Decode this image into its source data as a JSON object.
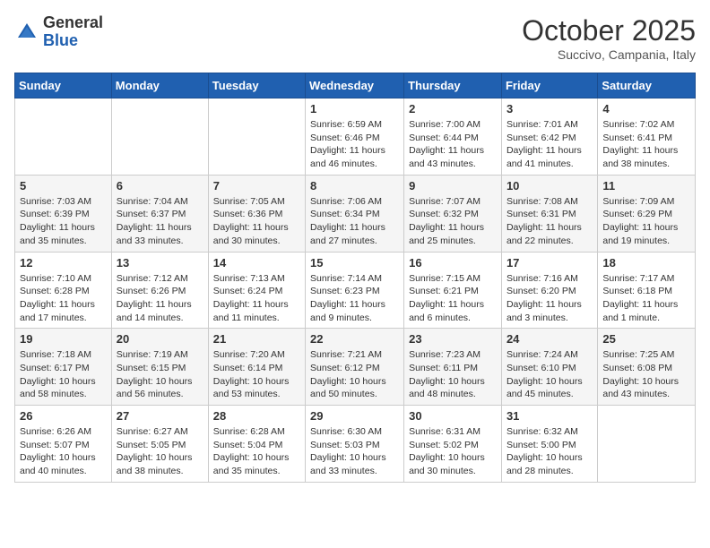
{
  "header": {
    "logo_general": "General",
    "logo_blue": "Blue",
    "month": "October 2025",
    "location": "Succivo, Campania, Italy"
  },
  "weekdays": [
    "Sunday",
    "Monday",
    "Tuesday",
    "Wednesday",
    "Thursday",
    "Friday",
    "Saturday"
  ],
  "weeks": [
    [
      {
        "day": "",
        "info": ""
      },
      {
        "day": "",
        "info": ""
      },
      {
        "day": "",
        "info": ""
      },
      {
        "day": "1",
        "info": "Sunrise: 6:59 AM\nSunset: 6:46 PM\nDaylight: 11 hours\nand 46 minutes."
      },
      {
        "day": "2",
        "info": "Sunrise: 7:00 AM\nSunset: 6:44 PM\nDaylight: 11 hours\nand 43 minutes."
      },
      {
        "day": "3",
        "info": "Sunrise: 7:01 AM\nSunset: 6:42 PM\nDaylight: 11 hours\nand 41 minutes."
      },
      {
        "day": "4",
        "info": "Sunrise: 7:02 AM\nSunset: 6:41 PM\nDaylight: 11 hours\nand 38 minutes."
      }
    ],
    [
      {
        "day": "5",
        "info": "Sunrise: 7:03 AM\nSunset: 6:39 PM\nDaylight: 11 hours\nand 35 minutes."
      },
      {
        "day": "6",
        "info": "Sunrise: 7:04 AM\nSunset: 6:37 PM\nDaylight: 11 hours\nand 33 minutes."
      },
      {
        "day": "7",
        "info": "Sunrise: 7:05 AM\nSunset: 6:36 PM\nDaylight: 11 hours\nand 30 minutes."
      },
      {
        "day": "8",
        "info": "Sunrise: 7:06 AM\nSunset: 6:34 PM\nDaylight: 11 hours\nand 27 minutes."
      },
      {
        "day": "9",
        "info": "Sunrise: 7:07 AM\nSunset: 6:32 PM\nDaylight: 11 hours\nand 25 minutes."
      },
      {
        "day": "10",
        "info": "Sunrise: 7:08 AM\nSunset: 6:31 PM\nDaylight: 11 hours\nand 22 minutes."
      },
      {
        "day": "11",
        "info": "Sunrise: 7:09 AM\nSunset: 6:29 PM\nDaylight: 11 hours\nand 19 minutes."
      }
    ],
    [
      {
        "day": "12",
        "info": "Sunrise: 7:10 AM\nSunset: 6:28 PM\nDaylight: 11 hours\nand 17 minutes."
      },
      {
        "day": "13",
        "info": "Sunrise: 7:12 AM\nSunset: 6:26 PM\nDaylight: 11 hours\nand 14 minutes."
      },
      {
        "day": "14",
        "info": "Sunrise: 7:13 AM\nSunset: 6:24 PM\nDaylight: 11 hours\nand 11 minutes."
      },
      {
        "day": "15",
        "info": "Sunrise: 7:14 AM\nSunset: 6:23 PM\nDaylight: 11 hours\nand 9 minutes."
      },
      {
        "day": "16",
        "info": "Sunrise: 7:15 AM\nSunset: 6:21 PM\nDaylight: 11 hours\nand 6 minutes."
      },
      {
        "day": "17",
        "info": "Sunrise: 7:16 AM\nSunset: 6:20 PM\nDaylight: 11 hours\nand 3 minutes."
      },
      {
        "day": "18",
        "info": "Sunrise: 7:17 AM\nSunset: 6:18 PM\nDaylight: 11 hours\nand 1 minute."
      }
    ],
    [
      {
        "day": "19",
        "info": "Sunrise: 7:18 AM\nSunset: 6:17 PM\nDaylight: 10 hours\nand 58 minutes."
      },
      {
        "day": "20",
        "info": "Sunrise: 7:19 AM\nSunset: 6:15 PM\nDaylight: 10 hours\nand 56 minutes."
      },
      {
        "day": "21",
        "info": "Sunrise: 7:20 AM\nSunset: 6:14 PM\nDaylight: 10 hours\nand 53 minutes."
      },
      {
        "day": "22",
        "info": "Sunrise: 7:21 AM\nSunset: 6:12 PM\nDaylight: 10 hours\nand 50 minutes."
      },
      {
        "day": "23",
        "info": "Sunrise: 7:23 AM\nSunset: 6:11 PM\nDaylight: 10 hours\nand 48 minutes."
      },
      {
        "day": "24",
        "info": "Sunrise: 7:24 AM\nSunset: 6:10 PM\nDaylight: 10 hours\nand 45 minutes."
      },
      {
        "day": "25",
        "info": "Sunrise: 7:25 AM\nSunset: 6:08 PM\nDaylight: 10 hours\nand 43 minutes."
      }
    ],
    [
      {
        "day": "26",
        "info": "Sunrise: 6:26 AM\nSunset: 5:07 PM\nDaylight: 10 hours\nand 40 minutes."
      },
      {
        "day": "27",
        "info": "Sunrise: 6:27 AM\nSunset: 5:05 PM\nDaylight: 10 hours\nand 38 minutes."
      },
      {
        "day": "28",
        "info": "Sunrise: 6:28 AM\nSunset: 5:04 PM\nDaylight: 10 hours\nand 35 minutes."
      },
      {
        "day": "29",
        "info": "Sunrise: 6:30 AM\nSunset: 5:03 PM\nDaylight: 10 hours\nand 33 minutes."
      },
      {
        "day": "30",
        "info": "Sunrise: 6:31 AM\nSunset: 5:02 PM\nDaylight: 10 hours\nand 30 minutes."
      },
      {
        "day": "31",
        "info": "Sunrise: 6:32 AM\nSunset: 5:00 PM\nDaylight: 10 hours\nand 28 minutes."
      },
      {
        "day": "",
        "info": ""
      }
    ]
  ]
}
